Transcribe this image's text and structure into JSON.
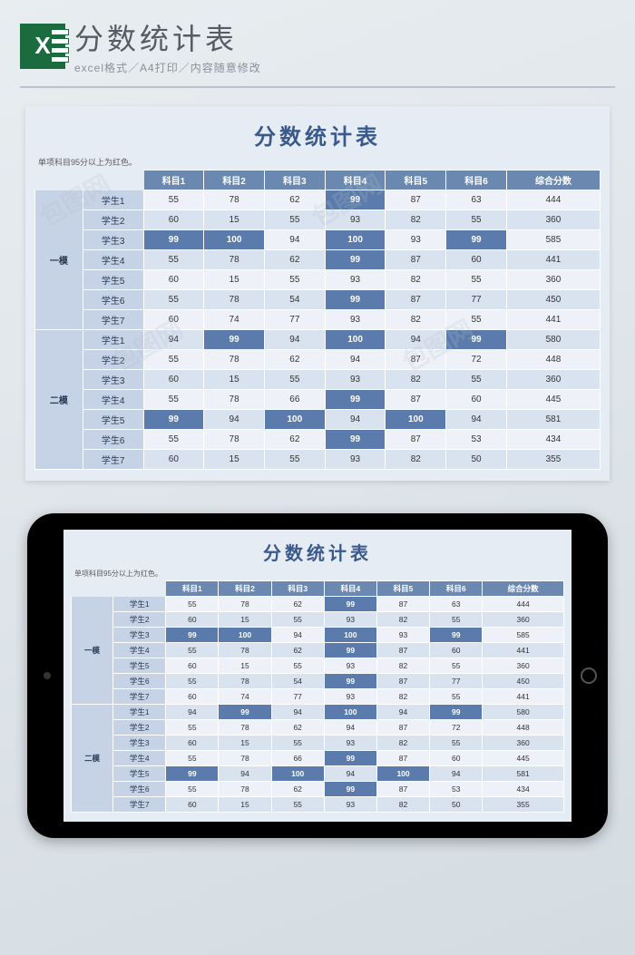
{
  "header": {
    "title": "分数统计表",
    "subtitle": "excel格式／A4打印／内容随意修改"
  },
  "sheet": {
    "title": "分数统计表",
    "note": "单项科目95分以上为红色。",
    "columns": [
      "科目1",
      "科目2",
      "科目3",
      "科目4",
      "科目5",
      "科目6",
      "综合分数"
    ],
    "groups": [
      {
        "name": "一模",
        "rows": [
          {
            "student": "学生1",
            "scores": [
              55,
              78,
              62,
              99,
              87,
              63,
              444
            ]
          },
          {
            "student": "学生2",
            "scores": [
              60,
              15,
              55,
              93,
              82,
              55,
              360
            ]
          },
          {
            "student": "学生3",
            "scores": [
              99,
              100,
              94,
              100,
              93,
              99,
              585
            ]
          },
          {
            "student": "学生4",
            "scores": [
              55,
              78,
              62,
              99,
              87,
              60,
              441
            ]
          },
          {
            "student": "学生5",
            "scores": [
              60,
              15,
              55,
              93,
              82,
              55,
              360
            ]
          },
          {
            "student": "学生6",
            "scores": [
              55,
              78,
              54,
              99,
              87,
              77,
              450
            ]
          },
          {
            "student": "学生7",
            "scores": [
              60,
              74,
              77,
              93,
              82,
              55,
              441
            ]
          }
        ]
      },
      {
        "name": "二模",
        "rows": [
          {
            "student": "学生1",
            "scores": [
              94,
              99,
              94,
              100,
              94,
              99,
              580
            ]
          },
          {
            "student": "学生2",
            "scores": [
              55,
              78,
              62,
              94,
              87,
              72,
              448
            ]
          },
          {
            "student": "学生3",
            "scores": [
              60,
              15,
              55,
              93,
              82,
              55,
              360
            ]
          },
          {
            "student": "学生4",
            "scores": [
              55,
              78,
              66,
              99,
              87,
              60,
              445
            ]
          },
          {
            "student": "学生5",
            "scores": [
              99,
              94,
              100,
              94,
              100,
              94,
              581
            ]
          },
          {
            "student": "学生6",
            "scores": [
              55,
              78,
              62,
              99,
              87,
              53,
              434
            ]
          },
          {
            "student": "学生7",
            "scores": [
              60,
              15,
              55,
              93,
              82,
              50,
              355
            ]
          }
        ]
      }
    ],
    "highlight_threshold": 95
  },
  "watermark": "包图网"
}
